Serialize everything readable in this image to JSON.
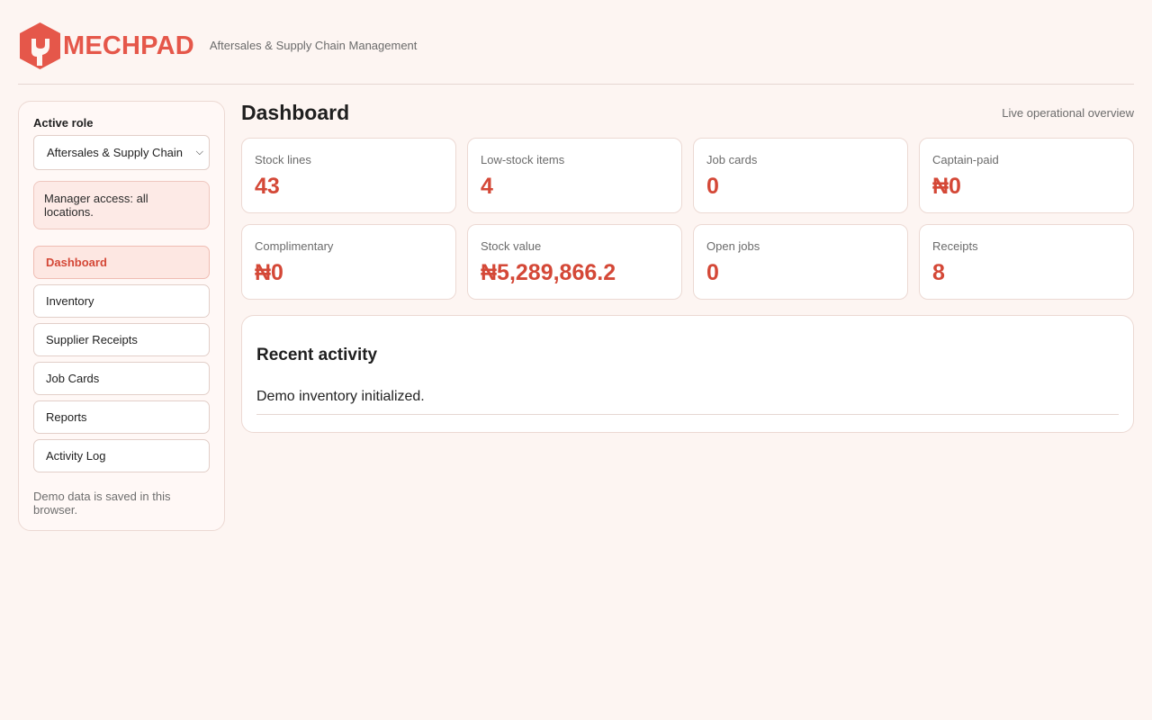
{
  "header": {
    "brand": "MECHPAD",
    "subtitle": "Aftersales & Supply Chain Management",
    "brand_color": "#e5574a"
  },
  "sidebar": {
    "role_label": "Active role",
    "role_value": "Aftersales & Supply Chain",
    "access_note": "Manager access: all locations.",
    "nav": [
      {
        "label": "Dashboard",
        "active": true
      },
      {
        "label": "Inventory",
        "active": false
      },
      {
        "label": "Supplier Receipts",
        "active": false
      },
      {
        "label": "Job Cards",
        "active": false
      },
      {
        "label": "Reports",
        "active": false
      },
      {
        "label": "Activity Log",
        "active": false
      }
    ],
    "demo_note": "Demo data is saved in this browser."
  },
  "main": {
    "title": "Dashboard",
    "subtitle": "Live operational overview",
    "stats": [
      {
        "label": "Stock lines",
        "value": "43"
      },
      {
        "label": "Low-stock items",
        "value": "4"
      },
      {
        "label": "Job cards",
        "value": "0"
      },
      {
        "label": "Captain-paid",
        "value": "₦0"
      },
      {
        "label": "Complimentary",
        "value": "₦0"
      },
      {
        "label": "Stock value",
        "value": "₦5,289,866.2"
      },
      {
        "label": "Open jobs",
        "value": "0"
      },
      {
        "label": "Receipts",
        "value": "8"
      }
    ],
    "activity": {
      "title": "Recent activity",
      "items": [
        "Demo inventory initialized."
      ]
    }
  },
  "colors": {
    "accent": "#d44837",
    "background": "#fdf5f2"
  }
}
